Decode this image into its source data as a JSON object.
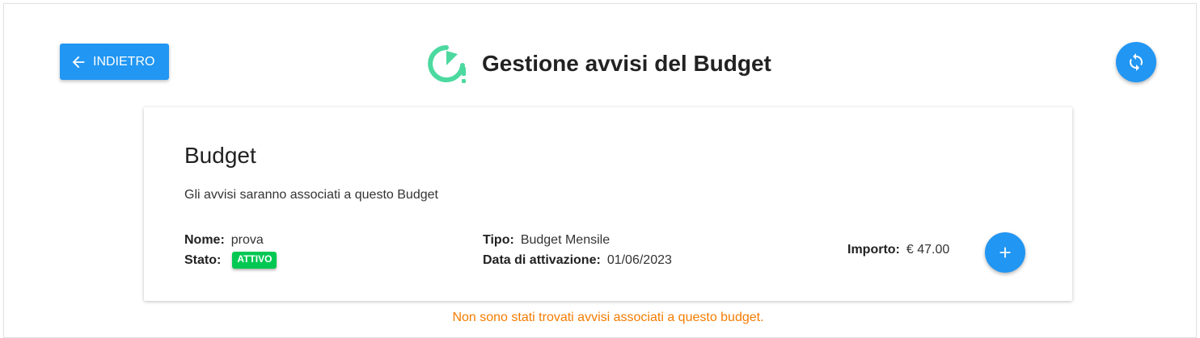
{
  "header": {
    "back_label": "INDIETRO",
    "title": "Gestione avvisi del Budget",
    "logo_icon": "budget-alert-icon",
    "refresh_icon": "refresh-icon"
  },
  "colors": {
    "primary": "#2196f3",
    "logo_green": "#4cd9a0",
    "badge_active": "#00c853",
    "warning_text": "#f57c00"
  },
  "card": {
    "title": "Budget",
    "subtitle": "Gli avvisi saranno associati a questo Budget",
    "fields": {
      "nome_label": "Nome:",
      "nome_value": "prova",
      "stato_label": "Stato:",
      "stato_value": "ATTIVO",
      "tipo_label": "Tipo:",
      "tipo_value": "Budget Mensile",
      "data_label": "Data di attivazione:",
      "data_value": "01/06/2023",
      "importo_label": "Importo:",
      "importo_value": "€ 47.00"
    },
    "add_icon": "plus-icon"
  },
  "empty_message": "Non sono stati trovati avvisi associati a questo budget."
}
